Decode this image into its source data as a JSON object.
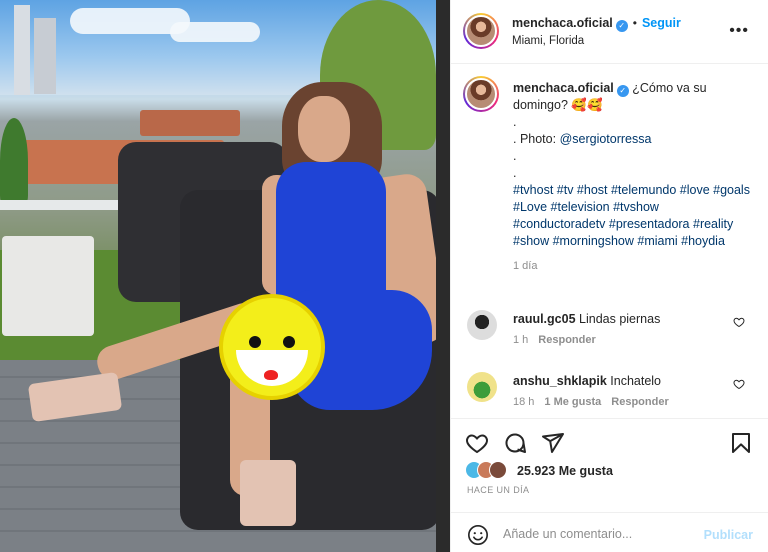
{
  "post": {
    "username": "menchaca.oficial",
    "verified_icon": "verified-badge-icon",
    "dot": "•",
    "follow_label": "Seguir",
    "location": "Miami, Florida",
    "more_icon": "more-options-icon",
    "more_glyph": "•••"
  },
  "caption": {
    "username": "menchaca.oficial",
    "text_main": "¿Cómo va su domingo? 🥰🥰",
    "dot1": ".",
    "photo_prefix": ". Photo: ",
    "photo_mention": "@sergiotorressa",
    "dot2": ".",
    "dot3": ".",
    "hashtags": "#tvhost #tv #host #telemundo #love #goals #Love #television #tvshow #conductoradetv #presentadora #reality #show #morningshow #miami #hoydia",
    "time": "1 día"
  },
  "comments": [
    {
      "username": "rauul.gc05",
      "text": "Lindas piernas",
      "time": "1 h",
      "likes": "",
      "reply": "Responder"
    },
    {
      "username": "anshu_shklapik",
      "text": "Inchatelo",
      "time": "18 h",
      "likes": "1 Me gusta",
      "reply": "Responder"
    }
  ],
  "actions": {
    "like_icon": "heart-icon",
    "comment_icon": "comment-icon",
    "share_icon": "share-icon",
    "save_icon": "bookmark-icon",
    "likes_count": "25.923",
    "likes_label": "Me gusta",
    "time_ago": "HACE UN DÍA"
  },
  "add_comment": {
    "placeholder": "Añade un comentario...",
    "publish_label": "Publicar"
  },
  "colors": {
    "accent": "#0095f6",
    "publish_disabled": "#b2dffc",
    "dress": "#1f44d6",
    "smiley": "#f3ee1a"
  }
}
